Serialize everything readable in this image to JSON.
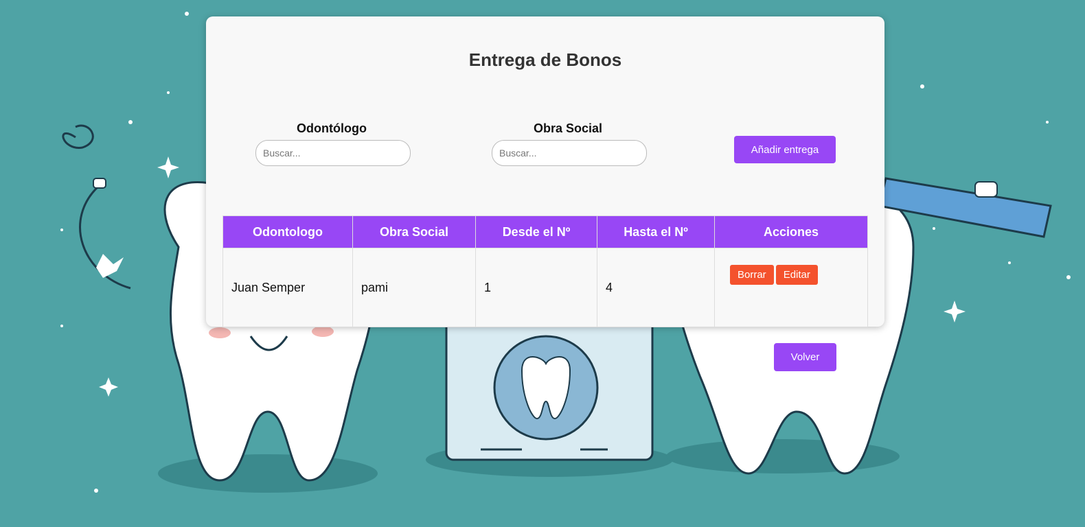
{
  "page": {
    "title": "Entrega de Bonos"
  },
  "filters": {
    "odontologo": {
      "label": "Odontólogo",
      "placeholder": "Buscar..."
    },
    "obra_social": {
      "label": "Obra Social",
      "placeholder": "Buscar..."
    },
    "add_label": "Añadir entrega"
  },
  "table": {
    "headers": [
      "Odontologo",
      "Obra Social",
      "Desde el Nº",
      "Hasta el Nº",
      "Acciones"
    ],
    "rows": [
      {
        "odontologo": "Juan Semper",
        "obra_social": "pami",
        "desde": "1",
        "hasta": "4",
        "actions": {
          "delete": "Borrar",
          "edit": "Editar"
        }
      }
    ]
  },
  "back_label": "Volver",
  "colors": {
    "accent": "#9847f5",
    "danger": "#f4522d",
    "background": "#4fa3a5"
  }
}
